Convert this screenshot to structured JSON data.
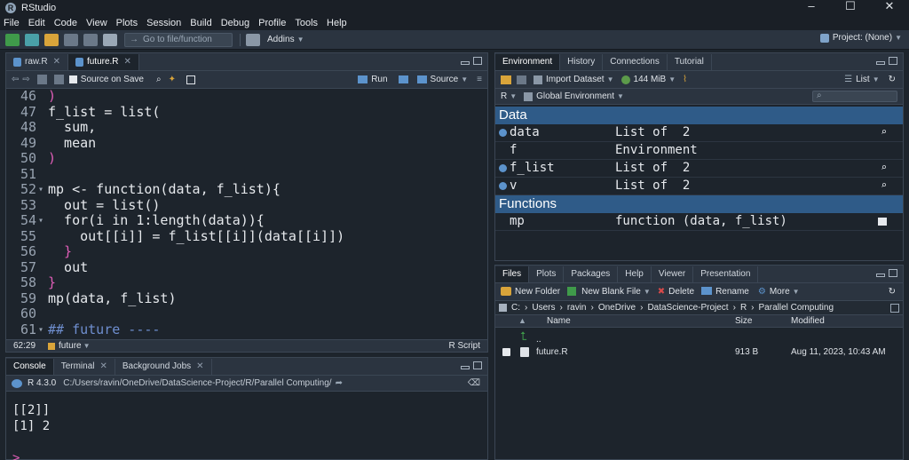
{
  "window": {
    "title": "RStudio"
  },
  "menu": [
    "File",
    "Edit",
    "Code",
    "View",
    "Plots",
    "Session",
    "Build",
    "Debug",
    "Profile",
    "Tools",
    "Help"
  ],
  "toolbar": {
    "goto_placeholder": "Go to file/function",
    "addins": "Addins",
    "project": "Project: (None)"
  },
  "editor": {
    "tabs": [
      {
        "label": "raw.R",
        "active": false
      },
      {
        "label": "future.R",
        "active": true
      }
    ],
    "source_on_save": "Source on Save",
    "run_label": "Run",
    "source_label": "Source",
    "status_position": "62:29",
    "status_scope": "future",
    "status_type": "R Script",
    "lines": [
      {
        "num": "46",
        "text": ")"
      },
      {
        "num": "47",
        "text": "f_list = list("
      },
      {
        "num": "48",
        "text": "  sum,"
      },
      {
        "num": "49",
        "text": "  mean"
      },
      {
        "num": "50",
        "text": ")"
      },
      {
        "num": "51",
        "text": ""
      },
      {
        "num": "52",
        "text": "mp <- function(data, f_list){"
      },
      {
        "num": "53",
        "text": "  out = list()"
      },
      {
        "num": "54",
        "text": "  for(i in 1:length(data)){"
      },
      {
        "num": "55",
        "text": "    out[[i]] = f_list[[i]](data[[i]])"
      },
      {
        "num": "56",
        "text": "  }"
      },
      {
        "num": "57",
        "text": "  out"
      },
      {
        "num": "58",
        "text": "}"
      },
      {
        "num": "59",
        "text": "mp(data, f_list)"
      },
      {
        "num": "60",
        "text": ""
      },
      {
        "num": "61",
        "text": "## future ----"
      }
    ]
  },
  "console": {
    "tabs": [
      {
        "label": "Console"
      },
      {
        "label": "Terminal"
      },
      {
        "label": "Background Jobs"
      }
    ],
    "r_version": "R 4.3.0",
    "path": "C:/Users/ravin/OneDrive/DataScience-Project/R/Parallel Computing/",
    "output": [
      "[[2]]",
      "[1] 2"
    ],
    "prompt": ">"
  },
  "environment": {
    "tabs": [
      "Environment",
      "History",
      "Connections",
      "Tutorial"
    ],
    "import_dataset": "Import Dataset",
    "memory": "144 MiB",
    "view_mode": "List",
    "language": "R",
    "scope": "Global Environment",
    "data_header": "Data",
    "data_rows": [
      {
        "name": "data",
        "value": "List of  2",
        "expandable": true
      },
      {
        "name": "f",
        "value": "Environment",
        "expandable": false
      },
      {
        "name": "f_list",
        "value": "List of  2",
        "expandable": true
      },
      {
        "name": "v",
        "value": "List of  2",
        "expandable": true
      }
    ],
    "functions_header": "Functions",
    "function_rows": [
      {
        "name": "mp",
        "value": "function (data, f_list)"
      }
    ]
  },
  "files": {
    "tabs": [
      "Files",
      "Plots",
      "Packages",
      "Help",
      "Viewer",
      "Presentation"
    ],
    "new_folder": "New Folder",
    "new_blank_file": "New Blank File",
    "delete": "Delete",
    "rename": "Rename",
    "more": "More",
    "path": [
      "C:",
      "Users",
      "ravin",
      "OneDrive",
      "DataScience-Project",
      "R",
      "Parallel Computing"
    ],
    "columns": {
      "name": "Name",
      "size": "Size",
      "modified": "Modified"
    },
    "up_label": "..",
    "rows": [
      {
        "name": "future.R",
        "size": "913 B",
        "modified": "Aug 11, 2023, 10:43 AM"
      }
    ]
  },
  "colors": {
    "accent": "#2f5b88",
    "keyword": "#e05eb8",
    "comment": "#6f8fd0",
    "background": "#1d242c"
  }
}
